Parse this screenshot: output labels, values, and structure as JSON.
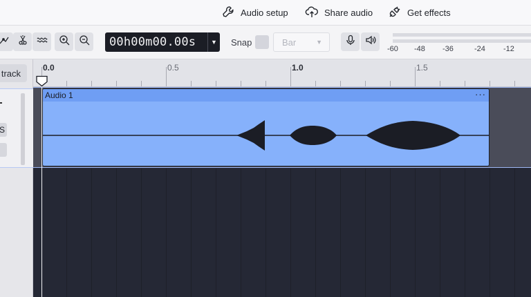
{
  "topbar": {
    "audio_setup": "Audio setup",
    "share_audio": "Share audio",
    "get_effects": "Get effects"
  },
  "toolbar": {
    "tools": [
      "envelope-tool",
      "multi-tool",
      "trim-tool",
      "zoom-in",
      "zoom-out"
    ],
    "timecode": "00h00m00.00s",
    "snap_label": "Snap",
    "snap_checked": false,
    "snap_value": "Bar",
    "meter_labels": [
      "-60",
      "-48",
      "-36",
      "-24",
      "-12"
    ]
  },
  "tracks_panel": {
    "add_track_label": "track",
    "solo_label": "S"
  },
  "ruler": {
    "major_labels": [
      "0.0",
      "1.0"
    ],
    "minor_labels": [
      "0.5",
      "1.5"
    ]
  },
  "clip": {
    "name": "Audio 1",
    "menu": "···",
    "color": "#86b1fb"
  }
}
